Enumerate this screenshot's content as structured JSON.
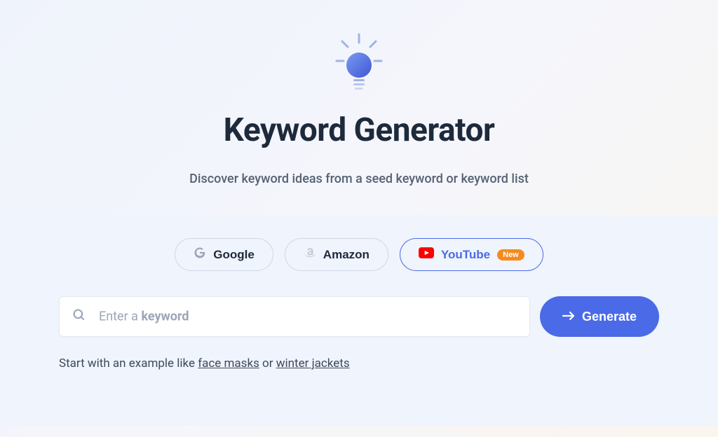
{
  "title": "Keyword Generator",
  "subtitle": "Discover keyword ideas from a seed keyword or keyword list",
  "tabs": [
    {
      "label": "Google",
      "icon": "google",
      "active": false,
      "badge": null
    },
    {
      "label": "Amazon",
      "icon": "amazon",
      "active": false,
      "badge": null
    },
    {
      "label": "YouTube",
      "icon": "youtube",
      "active": true,
      "badge": "New"
    }
  ],
  "search": {
    "placeholder_prefix": "Enter a ",
    "placeholder_bold": "keyword",
    "value": ""
  },
  "generateButton": "Generate",
  "exampleText": {
    "prefix": "Start with an example like ",
    "link1": "face masks",
    "middle": " or ",
    "link2": "winter jackets"
  }
}
